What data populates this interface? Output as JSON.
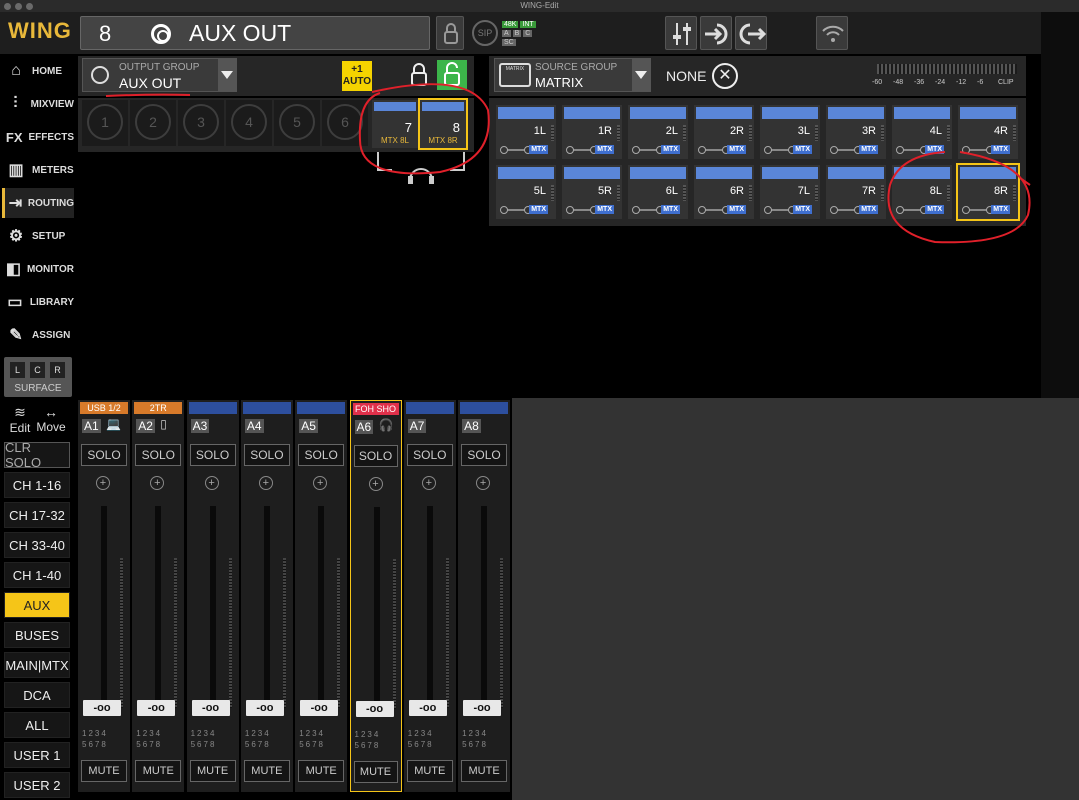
{
  "window": {
    "title": "WING-Edit"
  },
  "header": {
    "logo": "WING",
    "channel_number": "8",
    "channel_name": "AUX OUT",
    "badge_48k": "48K",
    "badge_int": "INT",
    "badge_a": "A",
    "badge_b": "B",
    "badge_c": "C",
    "badge_sc": "SC",
    "badge_sip": "SIP"
  },
  "nav": [
    {
      "label": "HOME",
      "icon": "home-icon"
    },
    {
      "label": "MIXVIEW",
      "icon": "mixview-icon"
    },
    {
      "label": "EFFECTS",
      "icon": "effects-icon"
    },
    {
      "label": "METERS",
      "icon": "meters-icon"
    },
    {
      "label": "ROUTING",
      "icon": "routing-icon",
      "active": true
    },
    {
      "label": "SETUP",
      "icon": "gear-icon"
    },
    {
      "label": "MONITOR",
      "icon": "monitor-icon"
    },
    {
      "label": "LIBRARY",
      "icon": "folder-icon"
    },
    {
      "label": "ASSIGN",
      "icon": "assign-icon"
    }
  ],
  "surface": {
    "l": "L",
    "c": "C",
    "r": "R",
    "label": "SURFACE",
    "edit": "Edit",
    "move": "Move"
  },
  "left_buttons": [
    "CLR SOLO",
    "CH 1-16",
    "CH 17-32",
    "CH 33-40",
    "CH 1-40",
    "AUX",
    "BUSES",
    "MAIN|MTX",
    "DCA",
    "ALL",
    "USER 1",
    "USER 2"
  ],
  "output": {
    "group_label": "OUTPUT GROUP",
    "group_value": "AUX OUT",
    "auto_label": "+1\nAUTO",
    "slots": [
      "1",
      "2",
      "3",
      "4",
      "5",
      "6"
    ],
    "tiles": [
      {
        "num": "7",
        "src": "MTX 8L"
      },
      {
        "num": "8",
        "src": "MTX 8R"
      }
    ]
  },
  "source": {
    "group_label": "SOURCE GROUP",
    "group_value": "MATRIX",
    "icon_text": "MATRIX",
    "none_label": "NONE",
    "meter_scale": [
      "-60",
      "-48",
      "-36",
      "-24",
      "-12",
      "-6",
      "CLIP"
    ],
    "tag": "MTX",
    "tiles": [
      "1L",
      "1R",
      "2L",
      "2R",
      "3L",
      "3R",
      "4L",
      "4R",
      "5L",
      "5R",
      "6L",
      "6R",
      "7L",
      "7R",
      "8L",
      "8R"
    ],
    "selected": "8R"
  },
  "strips": [
    {
      "hdr": "USB 1/2",
      "hdr_color": "#d77a2a",
      "id": "A1",
      "icon": "laptop-icon"
    },
    {
      "hdr": "2TR",
      "hdr_color": "#d77a2a",
      "id": "A2",
      "icon": "usb-icon"
    },
    {
      "hdr": "",
      "hdr_color": "#2d4f9e",
      "id": "A3",
      "icon": ""
    },
    {
      "hdr": "",
      "hdr_color": "#2d4f9e",
      "id": "A4",
      "icon": ""
    },
    {
      "hdr": "",
      "hdr_color": "#2d4f9e",
      "id": "A5",
      "icon": ""
    },
    {
      "hdr": "FOH SHO",
      "hdr_color": "#e0304a",
      "id": "A6",
      "icon": "headset-icon",
      "selected": true
    },
    {
      "hdr": "",
      "hdr_color": "#2d4f9e",
      "id": "A7",
      "icon": ""
    },
    {
      "hdr": "",
      "hdr_color": "#2d4f9e",
      "id": "A8",
      "icon": ""
    }
  ],
  "strip_labels": {
    "solo": "SOLO",
    "mute": "MUTE",
    "fader": "-oo",
    "plus": "+",
    "groups_row1": "1234",
    "groups_row2": "5678"
  }
}
